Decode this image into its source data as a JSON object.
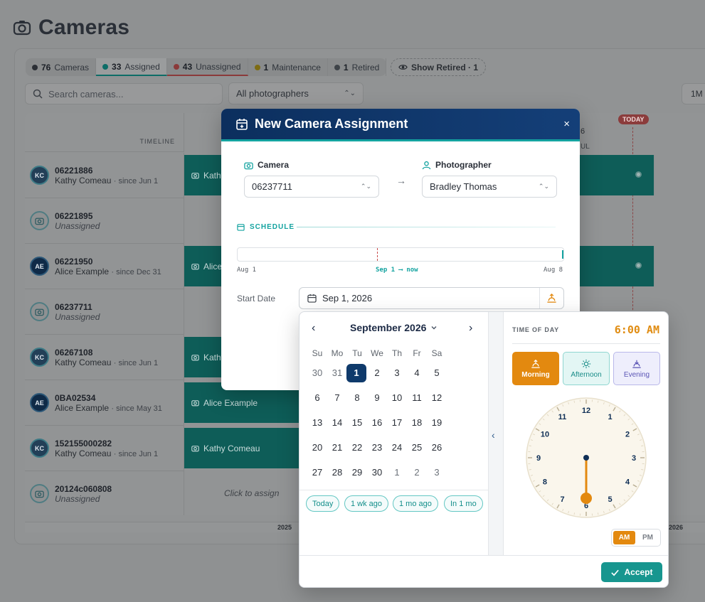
{
  "page": {
    "title": "Cameras",
    "filters": [
      {
        "count": "76",
        "label": "Cameras",
        "color": "#2b2f35"
      },
      {
        "count": "33",
        "label": "Assigned",
        "color": "#0d6d67"
      },
      {
        "count": "43",
        "label": "Unassigned",
        "color": "#8b3a3a"
      },
      {
        "count": "1",
        "label": "Maintenance",
        "color": "#7d6c14"
      },
      {
        "count": "1",
        "label": "Retired",
        "color": "#3f4449"
      }
    ],
    "show_retired": "Show Retired · 1",
    "search_placeholder": "Search cameras...",
    "photographer_filter": "All photographers",
    "zoom_label": "1M",
    "timeline_header": "TIMELINE",
    "today_badge": "TODAY",
    "header_partial_day": "6",
    "header_partial_month": "UL",
    "rows": [
      {
        "initials": "KC",
        "id": "06221886",
        "who": "Kathy Comeau",
        "since": "· since Jun 1",
        "bar": "Kathy"
      },
      {
        "initials": "",
        "id": "06221895",
        "who": "Unassigned",
        "since": "",
        "bar": ""
      },
      {
        "initials": "AE",
        "id": "06221950",
        "who": "Alice Example",
        "since": "· since Dec 31",
        "bar": "Alice"
      },
      {
        "initials": "",
        "id": "06237711",
        "who": "Unassigned",
        "since": "",
        "bar": ""
      },
      {
        "initials": "KC",
        "id": "06267108",
        "who": "Kathy Comeau",
        "since": "· since Jun 1",
        "bar": "Kathy"
      },
      {
        "initials": "AE",
        "id": "0BA02534",
        "who": "Alice Example",
        "since": "· since May 31",
        "bar": "Alice Example"
      },
      {
        "initials": "KC",
        "id": "152155000282",
        "who": "Kathy Comeau",
        "since": "· since Jun 1",
        "bar": "Kathy Comeau"
      },
      {
        "initials": "",
        "id": "20124c060808",
        "who": "Unassigned",
        "since": "",
        "bar": ""
      }
    ],
    "click_to_assign": "Click to assign",
    "axis_years": [
      "2025",
      "2026"
    ]
  },
  "modal": {
    "title": "New Camera Assignment",
    "close": "×",
    "camera_label": "Camera",
    "camera_value": "06237711",
    "photographer_label": "Photographer",
    "photographer_value": "Bradley Thomas",
    "schedule_label": "SCHEDULE",
    "schedule_start": "Aug 1",
    "schedule_now": "Sep 1 ⟶ now",
    "schedule_end": "Aug 8",
    "start_date_label": "Start Date",
    "start_date_value": "Sep 1, 2026"
  },
  "calendar": {
    "month_label": "September 2026",
    "prev": "‹",
    "next": "›",
    "weekdays": [
      "Su",
      "Mo",
      "Tu",
      "We",
      "Th",
      "Fr",
      "Sa"
    ],
    "weeks": [
      [
        "30",
        "31",
        "1",
        "2",
        "3",
        "4",
        "5"
      ],
      [
        "6",
        "7",
        "8",
        "9",
        "10",
        "11",
        "12"
      ],
      [
        "13",
        "14",
        "15",
        "16",
        "17",
        "18",
        "19"
      ],
      [
        "20",
        "21",
        "22",
        "23",
        "24",
        "25",
        "26"
      ],
      [
        "27",
        "28",
        "29",
        "30",
        "1",
        "2",
        "3"
      ]
    ],
    "selected_day": "1",
    "quick_buttons": [
      "Today",
      "1 wk ago",
      "1 mo ago",
      "In 1 mo"
    ]
  },
  "time": {
    "label": "TIME OF DAY",
    "value": "6:00 AM",
    "periods": [
      "Morning",
      "Afternoon",
      "Evening"
    ],
    "active_period": "Morning",
    "clock_numbers": [
      "12",
      "1",
      "2",
      "3",
      "4",
      "5",
      "6",
      "7",
      "8",
      "9",
      "10",
      "11"
    ],
    "selected_hour": 6,
    "am": "AM",
    "pm": "PM",
    "active_meridiem": "AM",
    "accept_label": "Accept",
    "colors": {
      "accent": "#e3890f",
      "teal": "#17968f",
      "navy": "#0f3a6b"
    }
  }
}
